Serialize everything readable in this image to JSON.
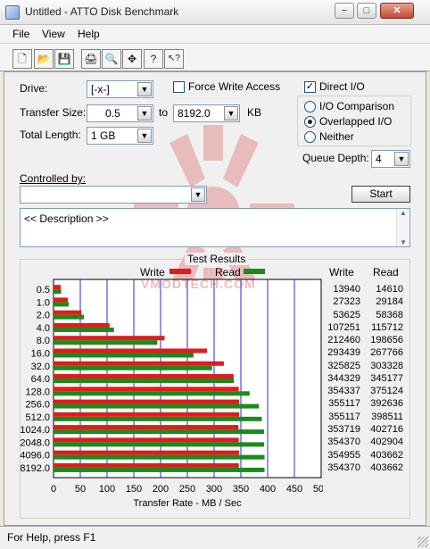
{
  "window": {
    "title": "Untitled - ATTO Disk Benchmark",
    "minimize_glyph": "−",
    "maximize_glyph": "□",
    "close_glyph": "✕"
  },
  "menu": [
    {
      "label": "File"
    },
    {
      "label": "View"
    },
    {
      "label": "Help"
    }
  ],
  "toolbar": {
    "buttons": [
      {
        "icon": "new-document-icon",
        "glyph": "🗋"
      },
      {
        "icon": "open-folder-icon",
        "glyph": "📂"
      },
      {
        "icon": "save-icon",
        "glyph": "💾"
      },
      {
        "icon": "print-icon",
        "glyph": "🖨"
      },
      {
        "icon": "print-preview-icon",
        "glyph": "🔍"
      },
      {
        "icon": "move-icon",
        "glyph": "✥"
      },
      {
        "icon": "help-icon",
        "glyph": "?"
      },
      {
        "icon": "context-help-icon",
        "glyph": "↖?"
      }
    ]
  },
  "settings": {
    "drive_label": "Drive:",
    "drive_value": "[-x-]",
    "force_write_label": "Force Write Access",
    "force_write_checked": false,
    "direct_io_label": "Direct I/O",
    "direct_io_checked": true,
    "transfer_size_label": "Transfer Size:",
    "transfer_size_from": "0.5",
    "transfer_size_to_label": "to",
    "transfer_size_to": "8192.0",
    "transfer_size_unit": "KB",
    "total_length_label": "Total Length:",
    "total_length_value": "1 GB",
    "io_options": [
      {
        "label": "I/O Comparison",
        "selected": false
      },
      {
        "label": "Overlapped I/O",
        "selected": true
      },
      {
        "label": "Neither",
        "selected": false
      }
    ],
    "queue_depth_label": "Queue Depth:",
    "queue_depth_value": "4",
    "controlled_by_label": "Controlled by:",
    "controlled_by_value": "",
    "start_label": "Start",
    "description": "<< Description >>"
  },
  "results": {
    "title": "Test Results",
    "legend_write": "Write",
    "legend_read": "Read",
    "col_write": "Write",
    "col_read": "Read",
    "watermark": "VMODTECH.COM",
    "rows": [
      {
        "size": "0.5",
        "write": "13940",
        "read": "14610"
      },
      {
        "size": "1.0",
        "write": "27323",
        "read": "29184"
      },
      {
        "size": "2.0",
        "write": "53625",
        "read": "58368"
      },
      {
        "size": "4.0",
        "write": "107251",
        "read": "115712"
      },
      {
        "size": "8.0",
        "write": "212460",
        "read": "198656"
      },
      {
        "size": "16.0",
        "write": "293439",
        "read": "267766"
      },
      {
        "size": "32.0",
        "write": "325825",
        "read": "303328"
      },
      {
        "size": "64.0",
        "write": "344329",
        "read": "345177"
      },
      {
        "size": "128.0",
        "write": "354337",
        "read": "375124"
      },
      {
        "size": "256.0",
        "write": "355117",
        "read": "392636"
      },
      {
        "size": "512.0",
        "write": "355117",
        "read": "398511"
      },
      {
        "size": "1024.0",
        "write": "353719",
        "read": "402716"
      },
      {
        "size": "2048.0",
        "write": "354370",
        "read": "402904"
      },
      {
        "size": "4096.0",
        "write": "354955",
        "read": "403662"
      },
      {
        "size": "8192.0",
        "write": "354370",
        "read": "403662"
      }
    ]
  },
  "chart_data": {
    "type": "bar",
    "orientation": "horizontal",
    "categories": [
      "0.5",
      "1.0",
      "2.0",
      "4.0",
      "8.0",
      "16.0",
      "32.0",
      "64.0",
      "128.0",
      "256.0",
      "512.0",
      "1024.0",
      "2048.0",
      "4096.0",
      "8192.0"
    ],
    "series": [
      {
        "name": "Write",
        "color": "#E21B1B",
        "values": [
          13.6,
          26.7,
          52.4,
          104.7,
          207.5,
          286.6,
          318.2,
          336.3,
          346.0,
          346.8,
          346.8,
          345.4,
          346.1,
          346.6,
          346.1
        ]
      },
      {
        "name": "Read",
        "color": "#1B8A1B",
        "values": [
          14.3,
          28.5,
          57.0,
          113.0,
          194.0,
          261.5,
          296.2,
          337.1,
          366.3,
          383.4,
          389.2,
          393.3,
          393.5,
          394.2,
          394.2
        ]
      }
    ],
    "xlabel": "Transfer Rate - MB / Sec",
    "xticks": [
      0,
      50,
      100,
      150,
      200,
      250,
      300,
      350,
      400,
      450,
      500
    ],
    "xlim": [
      0,
      500
    ],
    "grid": true,
    "legend": "top"
  },
  "status": {
    "text": "For Help, press F1"
  }
}
